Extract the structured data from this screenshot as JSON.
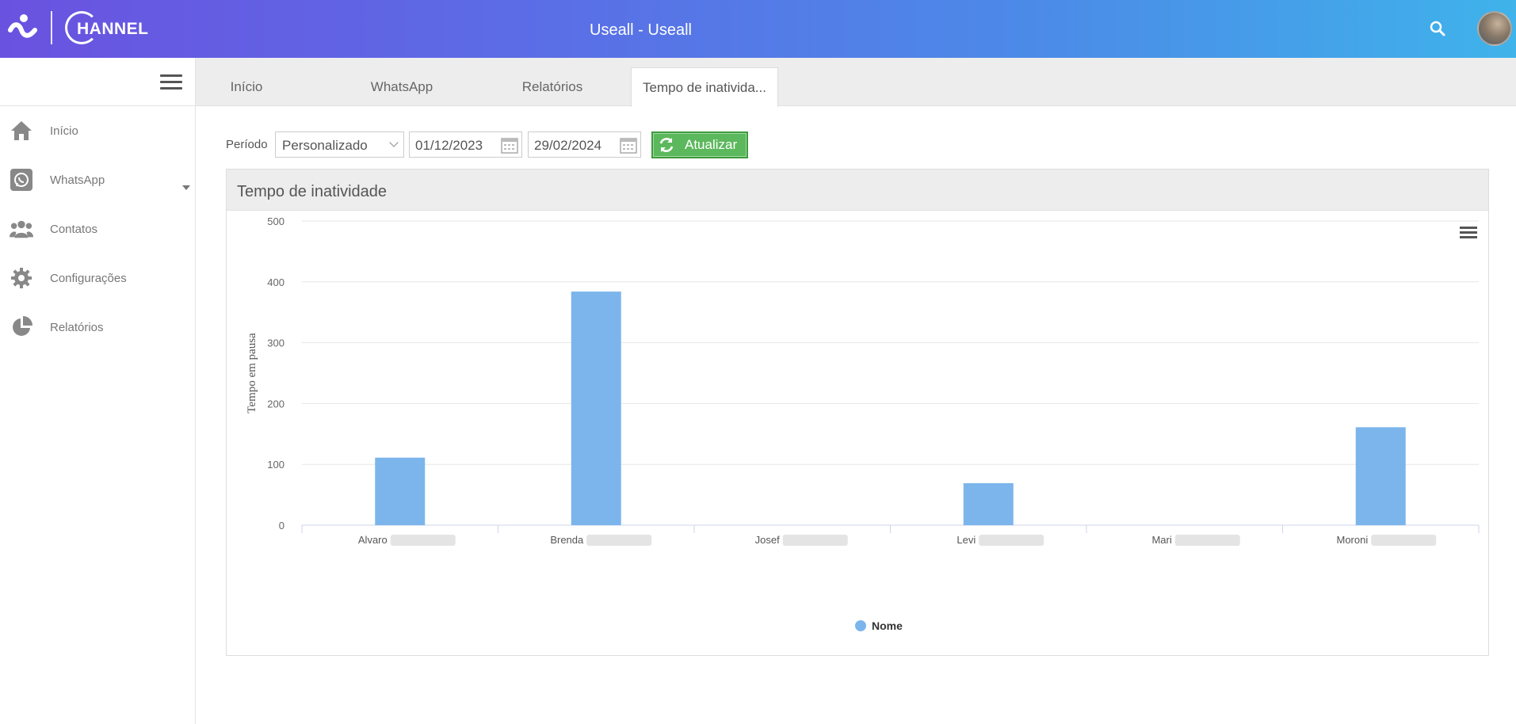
{
  "header": {
    "app_title": "Useall - Useall",
    "logo_text": "HANNEL",
    "search_icon": "search-icon",
    "avatar_icon": "user-avatar",
    "gradient": [
      "#6a52e0",
      "#3fb3ea"
    ]
  },
  "sidebar": {
    "items": [
      {
        "label": "Início",
        "icon": "home-icon"
      },
      {
        "label": "WhatsApp",
        "icon": "whatsapp-icon"
      },
      {
        "label": "Contatos",
        "icon": "contacts-icon"
      },
      {
        "label": "Configurações",
        "icon": "gear-icon"
      },
      {
        "label": "Relatórios",
        "icon": "pie-chart-icon"
      }
    ]
  },
  "tabs": [
    {
      "label": "Início",
      "active": false
    },
    {
      "label": "WhatsApp",
      "active": false
    },
    {
      "label": "Relatórios",
      "active": false
    },
    {
      "label": "Tempo de inativida...",
      "active": true
    }
  ],
  "filters": {
    "periodo_label": "Período",
    "periodo_value": "Personalizado",
    "date_start": "01/12/2023",
    "date_end": "29/02/2024",
    "refresh_label": "Atualizar",
    "refresh_color": "#5cb85c"
  },
  "panel": {
    "title": "Tempo de inatividade"
  },
  "chart_data": {
    "type": "bar",
    "categories": [
      "Alvaro",
      "Brenda",
      "Josef",
      "Levi",
      "Mari",
      "Moroni"
    ],
    "series": [
      {
        "name": "Nome",
        "color": "#7cb5ec",
        "values": [
          111,
          384,
          0,
          69,
          0,
          161
        ]
      }
    ],
    "xlabel": "",
    "ylabel": "Tempo em pausa",
    "ylim": [
      0,
      500
    ],
    "yticks": [
      0,
      100,
      200,
      300,
      400,
      500
    ],
    "grid": true,
    "legend_position": "bottom-center"
  }
}
